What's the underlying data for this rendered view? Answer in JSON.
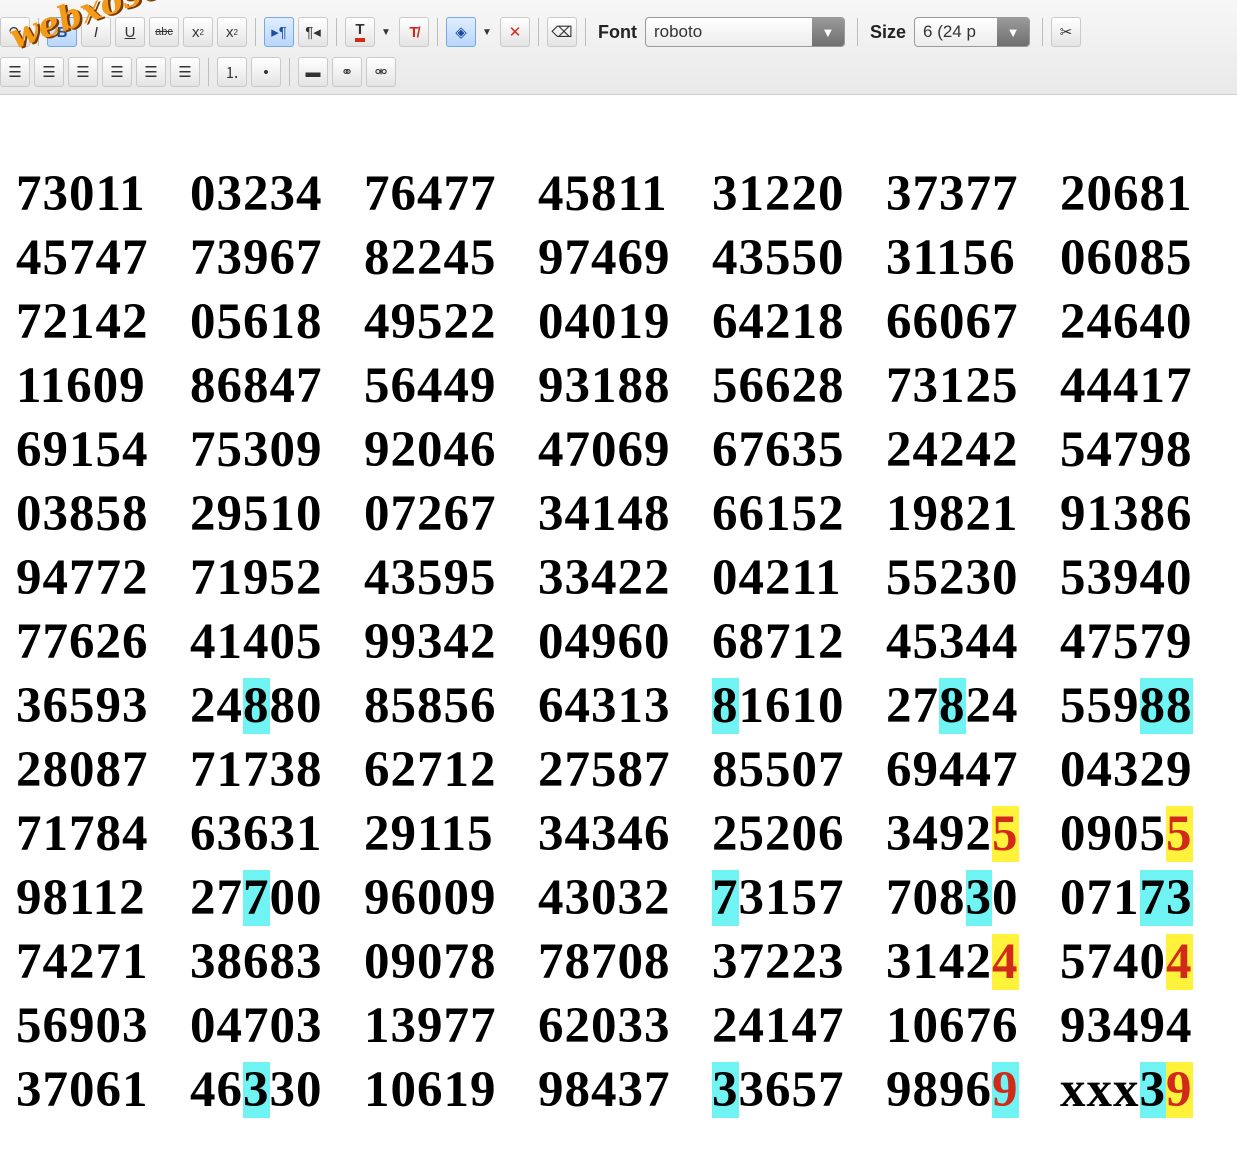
{
  "toolbar": {
    "font_label": "Font",
    "font_value": "roboto",
    "size_label": "Size",
    "size_value": "6 (24 p"
  },
  "watermark": "webxoso.net",
  "highlight_colors": {
    "cyan": "#6ff3f3",
    "yellow": "#fff23a",
    "red_text": "#d12a1a"
  },
  "numbers": [
    [
      "73011",
      "03234",
      "76477",
      "45811",
      "31220",
      "37377",
      "20681"
    ],
    [
      "45747",
      "73967",
      "82245",
      "97469",
      "43550",
      "31156",
      "06085"
    ],
    [
      "72142",
      "05618",
      "49522",
      "04019",
      "64218",
      "66067",
      "24640"
    ],
    [
      "11609",
      "86847",
      "56449",
      "93188",
      "56628",
      "73125",
      "44417"
    ],
    [
      "69154",
      "75309",
      "92046",
      "47069",
      "67635",
      "24242",
      "54798"
    ],
    [
      "03858",
      "29510",
      "07267",
      "34148",
      "66152",
      "19821",
      "91386"
    ],
    [
      "94772",
      "71952",
      "43595",
      "33422",
      "04211",
      "55230",
      "53940"
    ],
    [
      "77626",
      "41405",
      "99342",
      "04960",
      "68712",
      "45344",
      "47579"
    ],
    [
      "36593",
      "24880",
      "85856",
      "64313",
      "81610",
      "27824",
      "55988"
    ],
    [
      "28087",
      "71738",
      "62712",
      "27587",
      "85507",
      "69447",
      "04329"
    ],
    [
      "71784",
      "63631",
      "29115",
      "34346",
      "25206",
      "34925",
      "09055"
    ],
    [
      "98112",
      "27700",
      "96009",
      "43032",
      "73157",
      "70830",
      "07173"
    ],
    [
      "74271",
      "38683",
      "09078",
      "78708",
      "37223",
      "31424",
      "57404"
    ],
    [
      "56903",
      "04703",
      "13977",
      "62033",
      "24147",
      "10676",
      "93494"
    ],
    [
      "37061",
      "46330",
      "10619",
      "98437",
      "33657",
      "98969",
      "xxx39"
    ]
  ],
  "highlights": [
    {
      "row": 8,
      "col": 1,
      "start": 2,
      "len": 1,
      "style": "cyan"
    },
    {
      "row": 8,
      "col": 4,
      "start": 0,
      "len": 1,
      "style": "cyan"
    },
    {
      "row": 8,
      "col": 5,
      "start": 2,
      "len": 1,
      "style": "cyan"
    },
    {
      "row": 8,
      "col": 6,
      "start": 3,
      "len": 2,
      "style": "cyan"
    },
    {
      "row": 10,
      "col": 5,
      "start": 4,
      "len": 1,
      "style": "yellow"
    },
    {
      "row": 10,
      "col": 6,
      "start": 4,
      "len": 1,
      "style": "yellow"
    },
    {
      "row": 11,
      "col": 1,
      "start": 2,
      "len": 1,
      "style": "cyan"
    },
    {
      "row": 11,
      "col": 4,
      "start": 0,
      "len": 1,
      "style": "cyan"
    },
    {
      "row": 11,
      "col": 5,
      "start": 3,
      "len": 1,
      "style": "cyan"
    },
    {
      "row": 11,
      "col": 6,
      "start": 3,
      "len": 2,
      "style": "cyan"
    },
    {
      "row": 12,
      "col": 5,
      "start": 4,
      "len": 1,
      "style": "yellow"
    },
    {
      "row": 12,
      "col": 6,
      "start": 4,
      "len": 1,
      "style": "yellow"
    },
    {
      "row": 14,
      "col": 1,
      "start": 2,
      "len": 1,
      "style": "cyan"
    },
    {
      "row": 14,
      "col": 4,
      "start": 0,
      "len": 1,
      "style": "cyan"
    },
    {
      "row": 14,
      "col": 5,
      "start": 4,
      "len": 1,
      "style": "cyan-red"
    },
    {
      "row": 14,
      "col": 6,
      "start": 3,
      "len": 1,
      "style": "cyan"
    },
    {
      "row": 14,
      "col": 6,
      "start": 4,
      "len": 1,
      "style": "yellow-red"
    }
  ]
}
